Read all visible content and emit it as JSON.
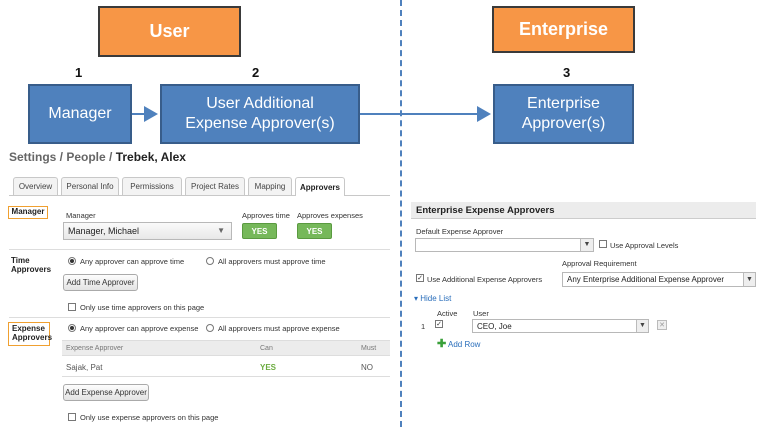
{
  "diagram": {
    "user_label": "User",
    "enterprise_label": "Enterprise",
    "steps": [
      {
        "number": "1",
        "label": "Manager"
      },
      {
        "number": "2",
        "label": "User Additional Expense Approver(s)"
      },
      {
        "number": "3",
        "label": "Enterprise Approver(s)"
      }
    ]
  },
  "settings": {
    "breadcrumb_prefix": "Settings / People / ",
    "breadcrumb_name": "Trebek, Alex",
    "tabs": [
      "Overview",
      "Personal Info",
      "Permissions",
      "Project Rates",
      "Mapping",
      "Approvers"
    ],
    "active_tab": "Approvers",
    "manager": {
      "section_label": "Manager",
      "field_label": "Manager",
      "value": "Manager, Michael",
      "approves_time_label": "Approves time",
      "approves_expenses_label": "Approves expenses",
      "time_value": "YES",
      "expenses_value": "YES"
    },
    "time_approvers": {
      "section_label": "Time Approvers",
      "option_any": "Any approver can approve time",
      "option_all": "All approvers must approve time",
      "add_button": "Add Time Approver",
      "only_label": "Only use time approvers on this page"
    },
    "expense_approvers": {
      "section_label": "Expense Approvers",
      "option_any": "Any approver can approve expense",
      "option_all": "All approvers must approve expense",
      "columns": [
        "Expense Approver",
        "Can",
        "Must"
      ],
      "rows": [
        [
          "Sajak, Pat",
          "YES",
          "NO"
        ]
      ],
      "add_button": "Add Expense Approver",
      "only_label": "Only use expense approvers on this page"
    }
  },
  "enterprise_panel": {
    "title": "Enterprise Expense Approvers",
    "default_label": "Default Expense Approver",
    "default_value": "",
    "use_levels_label": "Use Approval Levels",
    "approval_requirement_label": "Approval Requirement",
    "use_additional_label": "Use Additional Expense Approvers",
    "approval_requirement_value": "Any Enterprise Additional Expense Approver",
    "hide_list": "Hide List",
    "col_active": "Active",
    "col_user": "User",
    "row_index": "1",
    "row_user": "CEO, Joe",
    "add_row": "Add Row"
  },
  "colors": {
    "orange": "#f79646",
    "blue": "#4f81bd",
    "green": "#76b85a",
    "link": "#2a6ebb"
  }
}
